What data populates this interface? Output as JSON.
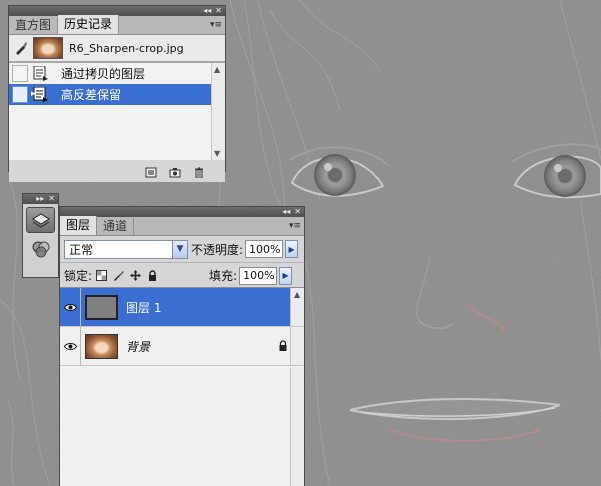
{
  "history_panel": {
    "tabs": [
      {
        "label": "直方图",
        "active": false
      },
      {
        "label": "历史记录",
        "active": true
      }
    ],
    "snapshot": {
      "name": "R6_Sharpen-crop.jpg"
    },
    "states": [
      {
        "label": "通过拷贝的图层",
        "selected": false
      },
      {
        "label": "高反差保留",
        "selected": true
      }
    ],
    "footer_icons": [
      "new-document-from-state-icon",
      "camera-snapshot-icon",
      "trash-icon"
    ]
  },
  "dock": {
    "buttons": [
      "layers-panel-icon",
      "channels-panel-icon"
    ]
  },
  "layers_panel": {
    "tabs": [
      {
        "label": "图层",
        "active": true
      },
      {
        "label": "通道",
        "active": false
      }
    ],
    "blend_mode": "正常",
    "opacity_label": "不透明度:",
    "opacity_value": "100%",
    "lock_label": "锁定:",
    "fill_label": "填充:",
    "fill_value": "100%",
    "layers": [
      {
        "name": "图层 1",
        "selected": true,
        "visible": true,
        "locked": false
      },
      {
        "name": "背景",
        "selected": false,
        "visible": true,
        "locked": true
      }
    ]
  },
  "colors": {
    "selection": "#3a6ed0",
    "panel_bg": "#d6d6d6",
    "canvas_gray": "#8a8a8a"
  }
}
